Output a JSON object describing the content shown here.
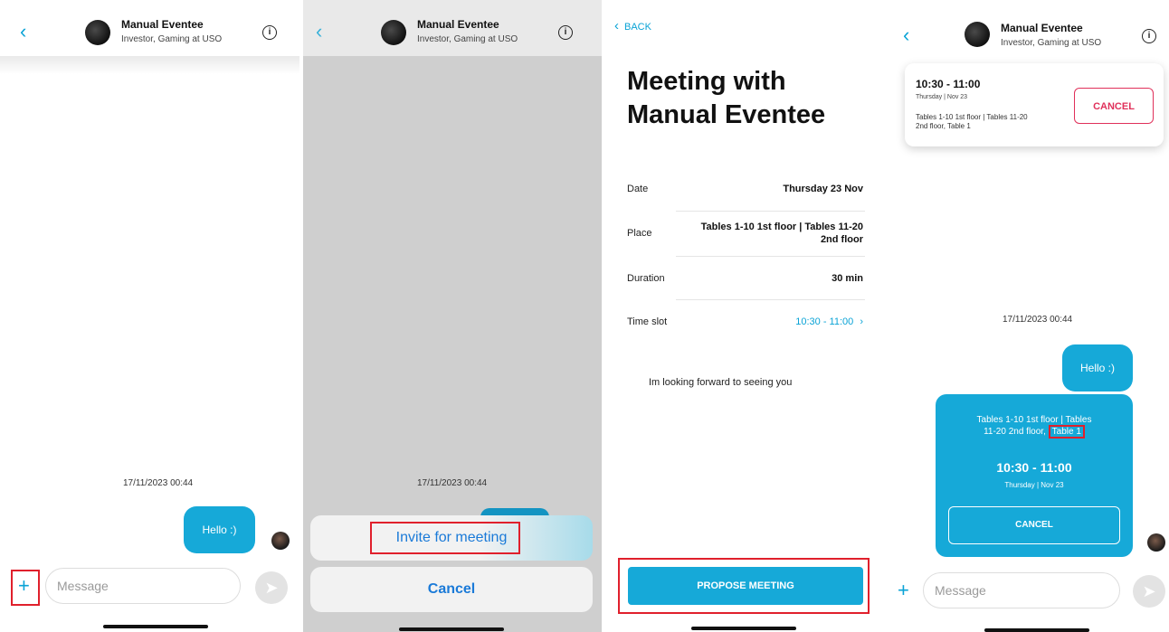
{
  "contact": {
    "name": "Manual Eventee",
    "subtitle": "Investor, Gaming at USO"
  },
  "chat": {
    "timestamp": "17/11/2023 00:44",
    "message": "Hello :)",
    "input_placeholder": "Message"
  },
  "action_sheet": {
    "invite_label": "Invite for meeting",
    "cancel_label": "Cancel"
  },
  "meeting_form": {
    "back_label": "BACK",
    "title_line1": "Meeting with",
    "title_line2": "Manual Eventee",
    "rows": [
      {
        "label": "Date",
        "value": "Thursday 23 Nov"
      },
      {
        "label": "Place",
        "value_line1": "Tables 1-10 1st floor | Tables 11-20",
        "value_line2": "2nd floor"
      },
      {
        "label": "Duration",
        "value": "30 min"
      },
      {
        "label": "Time slot",
        "value": "10:30 - 11:00"
      }
    ],
    "note": "Im looking forward to seeing you",
    "propose_label": "PROPOSE MEETING"
  },
  "meeting_card_top": {
    "time": "10:30 - 11:00",
    "date": "Thursday | Nov 23",
    "place_line1": "Tables 1-10 1st floor | Tables 11-20",
    "place_line2": "2nd floor, Table 1",
    "cancel_label": "CANCEL"
  },
  "meeting_bubble": {
    "place_line1": "Tables 1-10 1st floor | Tables",
    "place_line2_prefix": "11-20 2nd floor,",
    "place_highlight": "Table 1",
    "time": "10:30 - 11:00",
    "date": "Thursday | Nov 23",
    "cancel_label": "CANCEL"
  },
  "colors": {
    "accent": "#0aa3d6",
    "bubble": "#16a9d8",
    "cancel_red": "#e0305a",
    "highlight_box": "#e0202c"
  },
  "icons": [
    "back-chevron-icon",
    "info-icon",
    "plus-icon",
    "send-icon",
    "chevron-right-icon"
  ]
}
